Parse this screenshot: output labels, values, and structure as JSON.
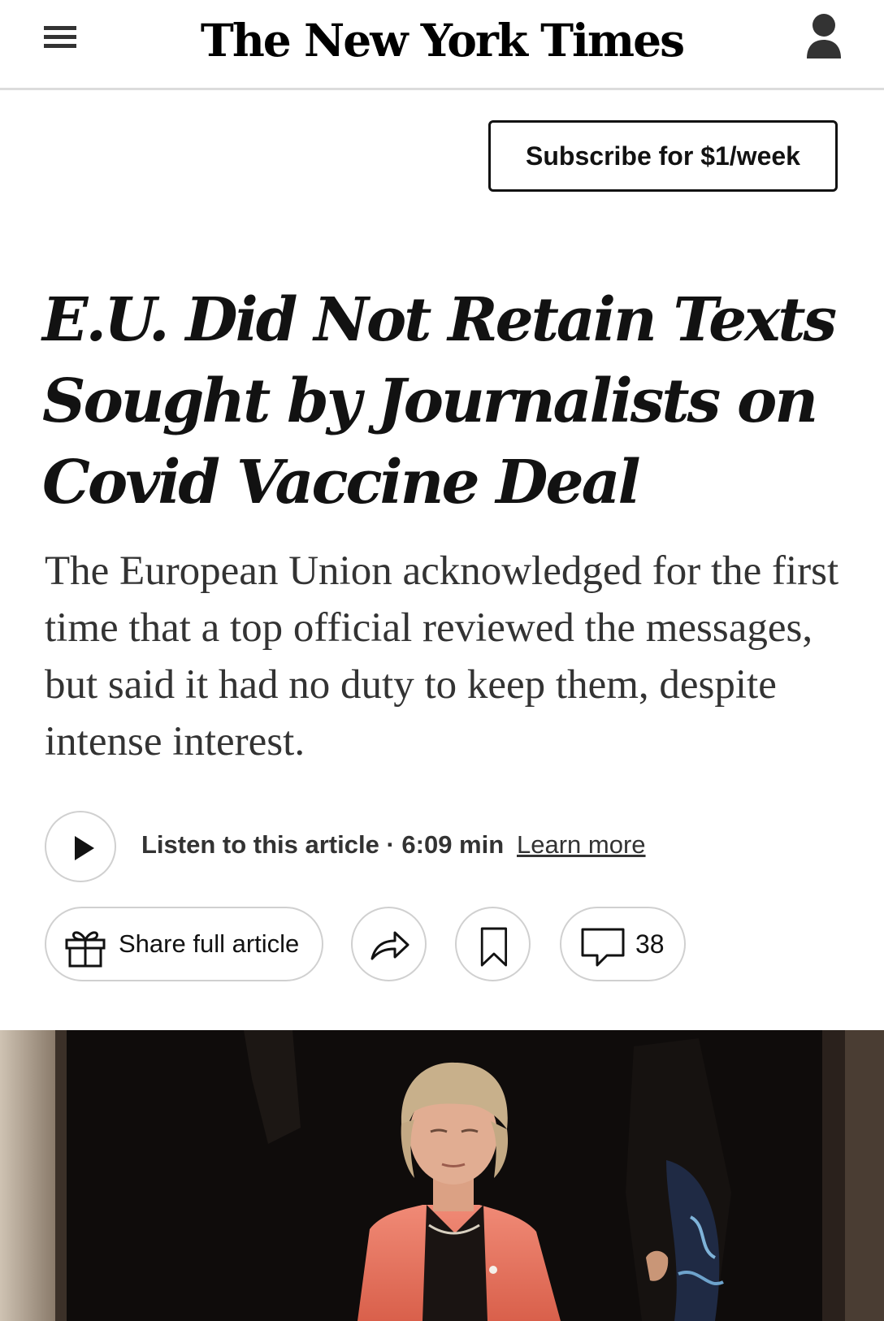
{
  "header": {
    "logo_text": "The New York Times",
    "menu_icon": "hamburger-menu-icon",
    "account_icon": "account-person-icon"
  },
  "subscribe": {
    "label": "Subscribe for $1/week"
  },
  "article": {
    "headline": "E.U. Did Not Retain Texts Sought by Journalists on Covid Vaccine Deal",
    "summary": "The European Union acknowledged for the first time that a top official reviewed the messages, but said it had no duty to keep them, despite intense interest."
  },
  "audio": {
    "play_icon": "play-icon",
    "listen_label": "Listen to this article · 6:09 min",
    "learn_more": "Learn more"
  },
  "actions": {
    "share_label": "Share full article",
    "share_icon": "gift-icon",
    "forward_icon": "share-arrow-icon",
    "bookmark_icon": "bookmark-icon",
    "comment_icon": "comment-bubble-icon",
    "comment_count": "38"
  },
  "colors": {
    "text": "#121212",
    "summary_text": "#333333",
    "border": "#d0d0d0",
    "jacket": "#e8735f"
  }
}
